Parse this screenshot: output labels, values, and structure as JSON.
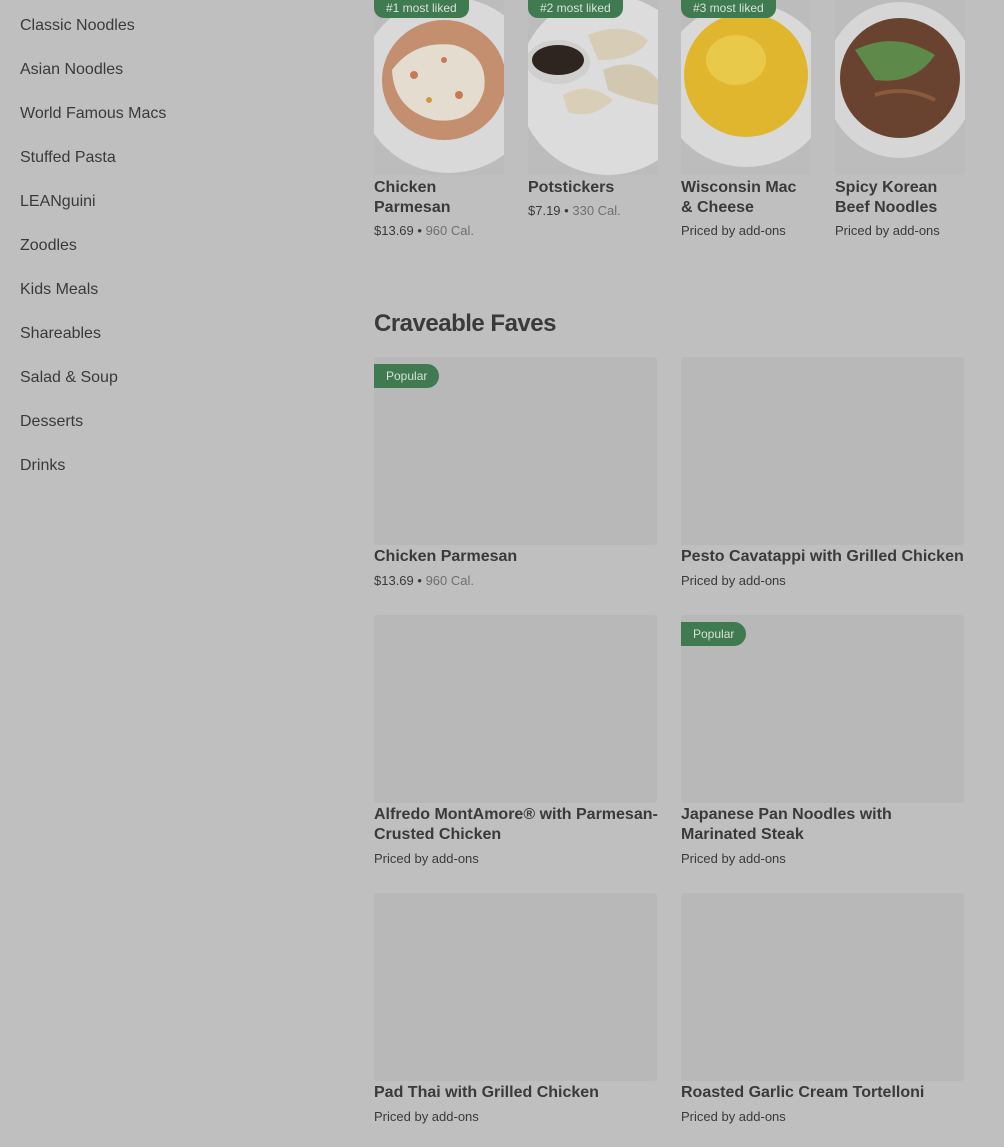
{
  "sidebar": {
    "items": [
      {
        "label": "Classic Noodles"
      },
      {
        "label": "Asian Noodles"
      },
      {
        "label": "World Famous Macs"
      },
      {
        "label": "Stuffed Pasta"
      },
      {
        "label": "LEANguini"
      },
      {
        "label": "Zoodles"
      },
      {
        "label": "Kids Meals"
      },
      {
        "label": "Shareables"
      },
      {
        "label": "Salad & Soup"
      },
      {
        "label": "Desserts"
      },
      {
        "label": "Drinks"
      }
    ]
  },
  "most_liked": [
    {
      "badge": "#1 most liked",
      "name": "Chicken Parmesan",
      "price": "$13.69",
      "sep": "•",
      "cal": "960 Cal."
    },
    {
      "badge": "#2 most liked",
      "name": "Potstickers",
      "price": "$7.19",
      "sep": "•",
      "cal": "330 Cal."
    },
    {
      "badge": "#3 most liked",
      "name": "Wisconsin Mac & Cheese",
      "price_text": "Priced by add-ons"
    },
    {
      "name": "Spicy Korean Beef Noodles",
      "price_text": "Priced by add-ons"
    }
  ],
  "craveable": {
    "title": "Craveable Faves",
    "items": [
      {
        "badge": "Popular",
        "name": "Chicken Parmesan",
        "price": "$13.69",
        "sep": "•",
        "cal": "960 Cal."
      },
      {
        "name": "Pesto Cavatappi with Grilled Chicken",
        "price_text": "Priced by add-ons"
      },
      {
        "name": "Alfredo MontAmore® with Parmesan-Crusted Chicken",
        "price_text": "Priced by add-ons"
      },
      {
        "badge": "Popular",
        "name": "Japanese Pan Noodles with Marinated Steak",
        "price_text": "Priced by add-ons"
      },
      {
        "name": "Pad Thai with Grilled Chicken",
        "price_text": "Priced by add-ons"
      },
      {
        "name": "Roasted Garlic Cream Tortelloni",
        "price_text": "Priced by add-ons"
      }
    ]
  }
}
